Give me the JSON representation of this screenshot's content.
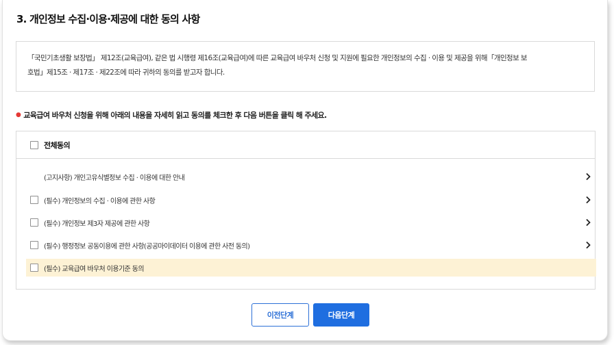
{
  "section": {
    "title": "3. 개인정보 수집·이용·제공에 대한 동의 사항"
  },
  "notice": {
    "line1": "「국민기초생활 보장법」 제12조(교육급여), 같은 법 시행령 제16조(교육급여)에 따른 교육급여 바우처 신청 및 지원에 필요한 개인정보의 수집 · 이용 및 제공을 위해「개인정보 보",
    "line2": "호법」제15조 · 제17조 · 제22조에 따라 귀하의 동의를 받고자 합니다."
  },
  "instruction": {
    "bullet": "●",
    "text": "교육급여 바우처 신청을 위해 아래의 내용을 자세히 읽고 동의를 체크한 후 다음 버튼을 클릭 해 주세요."
  },
  "consent": {
    "all_label": "전체동의",
    "items": [
      {
        "label": "(고지사항) 개인고유식별정보 수집 · 이용에 대한 안내"
      },
      {
        "label": "(필수) 개인정보의 수집 · 이용에 관한 사항"
      },
      {
        "label": "(필수) 개인정보 제3자 제공에 관한 사항"
      },
      {
        "label": "(필수) 행정정보 공동이용에 관한 사항(공공마이데이터 이용에 관한 사전 동의)"
      },
      {
        "label": "(필수) 교육급여 바우처 이용기준 동의"
      }
    ]
  },
  "buttons": {
    "prev_label": "이전단계",
    "next_label": "다음단계"
  },
  "colors": {
    "primary": "#1f6ee0",
    "highlight_row": "#fdf2d5",
    "required_bullet": "#e53935"
  }
}
